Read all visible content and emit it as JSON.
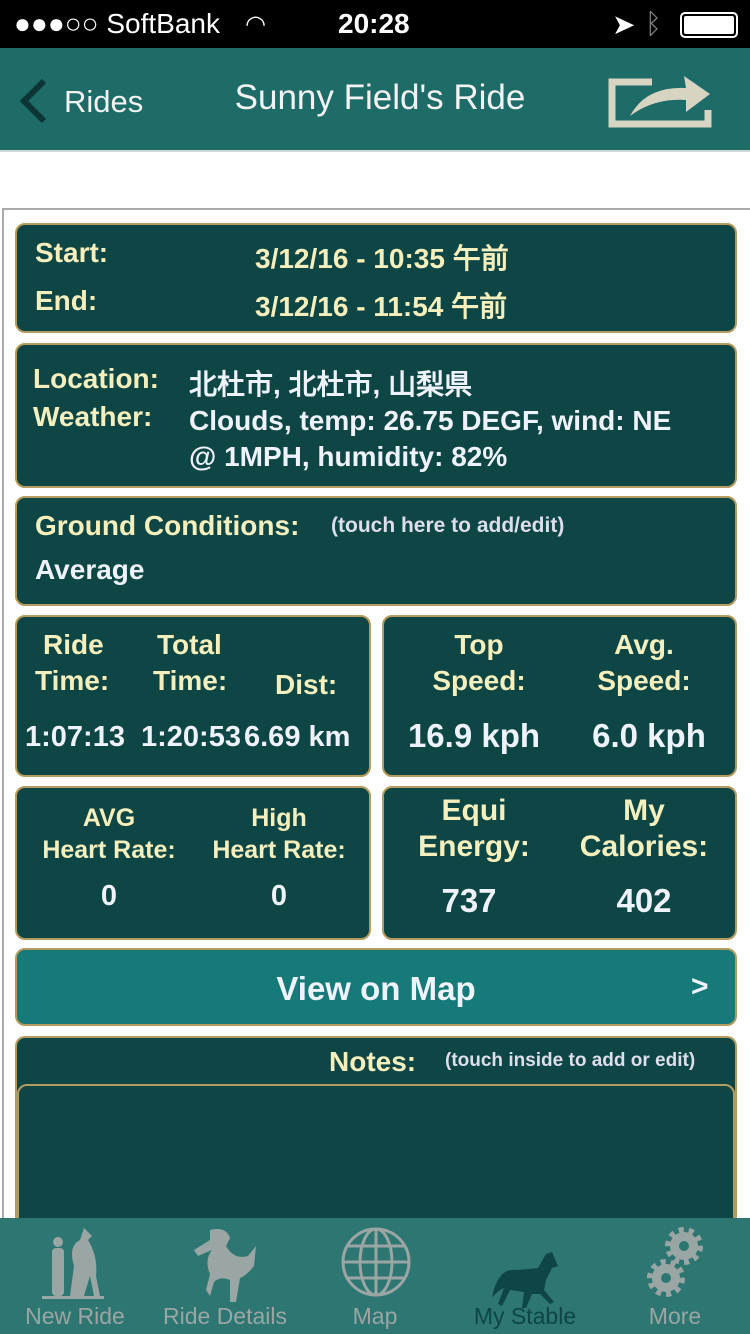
{
  "status": {
    "carrier": "●●●○○ SoftBank",
    "time": "20:28"
  },
  "nav": {
    "back_label": "Rides",
    "title": "Sunny Field's Ride",
    "share_icon": "share-icon"
  },
  "times": {
    "start_label": "Start:",
    "start_value": "3/12/16 - 10:35 午前",
    "end_label": "End:",
    "end_value": "3/12/16 - 11:54 午前"
  },
  "location": {
    "location_label": "Location:",
    "location_value": "北杜市, 北杜市, 山梨県",
    "weather_label": "Weather:",
    "weather_line1": "Clouds, temp: 26.75 DEGF, wind: NE",
    "weather_line2": "@ 1MPH, humidity: 82%"
  },
  "ground": {
    "label": "Ground Conditions:",
    "hint": "(touch here to add/edit)",
    "value": "Average"
  },
  "time_stats": {
    "ride_l1": "Ride",
    "ride_l2": "Time:",
    "total_l1": "Total",
    "total_l2": "Time:",
    "dist_label": "Dist:",
    "ride_value": "1:07:13",
    "total_value": "1:20:53",
    "dist_value": "6.69 km"
  },
  "speed": {
    "top_l1": "Top",
    "top_l2": "Speed:",
    "avg_l1": "Avg.",
    "avg_l2": "Speed:",
    "top_value": "16.9 kph",
    "avg_value": "6.0 kph"
  },
  "heart": {
    "avg_l1": "AVG",
    "avg_l2": "Heart Rate:",
    "high_l1": "High",
    "high_l2": "Heart Rate:",
    "avg_value": "0",
    "high_value": "0"
  },
  "energy": {
    "equi_l1": "Equi",
    "equi_l2": "Energy:",
    "cal_l1": "My",
    "cal_l2": "Calories:",
    "equi_value": "737",
    "cal_value": "402"
  },
  "map_button": {
    "label": "View on Map",
    "chevron": ">"
  },
  "notes": {
    "label": "Notes:",
    "hint": "(touch inside to add or edit)",
    "value": ""
  },
  "tabs": [
    {
      "label": "New Ride"
    },
    {
      "label": "Ride Details"
    },
    {
      "label": "Map"
    },
    {
      "label": "My Stable",
      "active": true
    },
    {
      "label": "More"
    }
  ],
  "colors": {
    "header": "#1d6c68",
    "panel": "#0e4545",
    "border": "#b49c5e",
    "label": "#f4efbc",
    "button": "#157a78",
    "tabbar": "#2e7672",
    "tab_active": "#0e4545"
  }
}
